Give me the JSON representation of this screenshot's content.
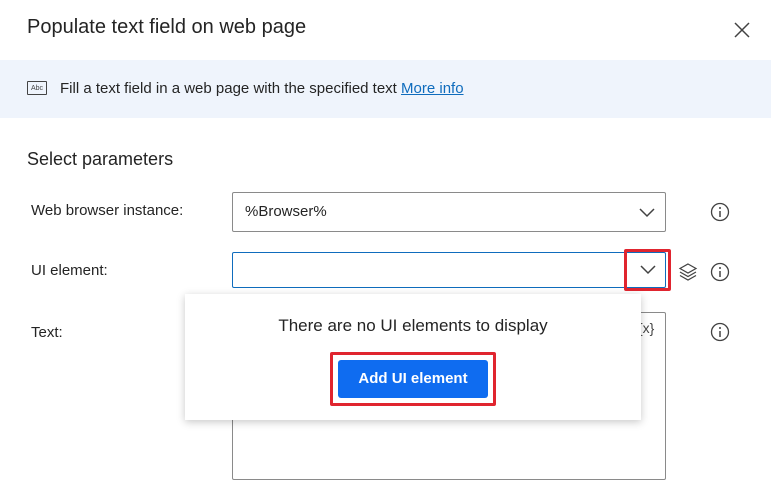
{
  "dialog": {
    "title": "Populate text field on web page"
  },
  "banner": {
    "description": "Fill a text field in a web page with the specified text ",
    "link": "More info",
    "icon_text": "Abc"
  },
  "section": {
    "title": "Select parameters"
  },
  "fields": {
    "browser": {
      "label": "Web browser instance:",
      "value": "%Browser%"
    },
    "ui_element": {
      "label": "UI element:",
      "value": ""
    },
    "text": {
      "label": "Text:",
      "value": "",
      "var_icon": "{x}"
    }
  },
  "dropdown": {
    "empty_message": "There are no UI elements to display",
    "add_button": "Add UI element"
  },
  "colors": {
    "accent": "#0f6cf0",
    "highlight": "#e0252f",
    "banner_bg": "#eff4fc",
    "link": "#0f6cbd"
  },
  "icons": [
    "close-icon",
    "text-field-icon",
    "chevron-down-icon",
    "layers-icon",
    "info-icon"
  ]
}
